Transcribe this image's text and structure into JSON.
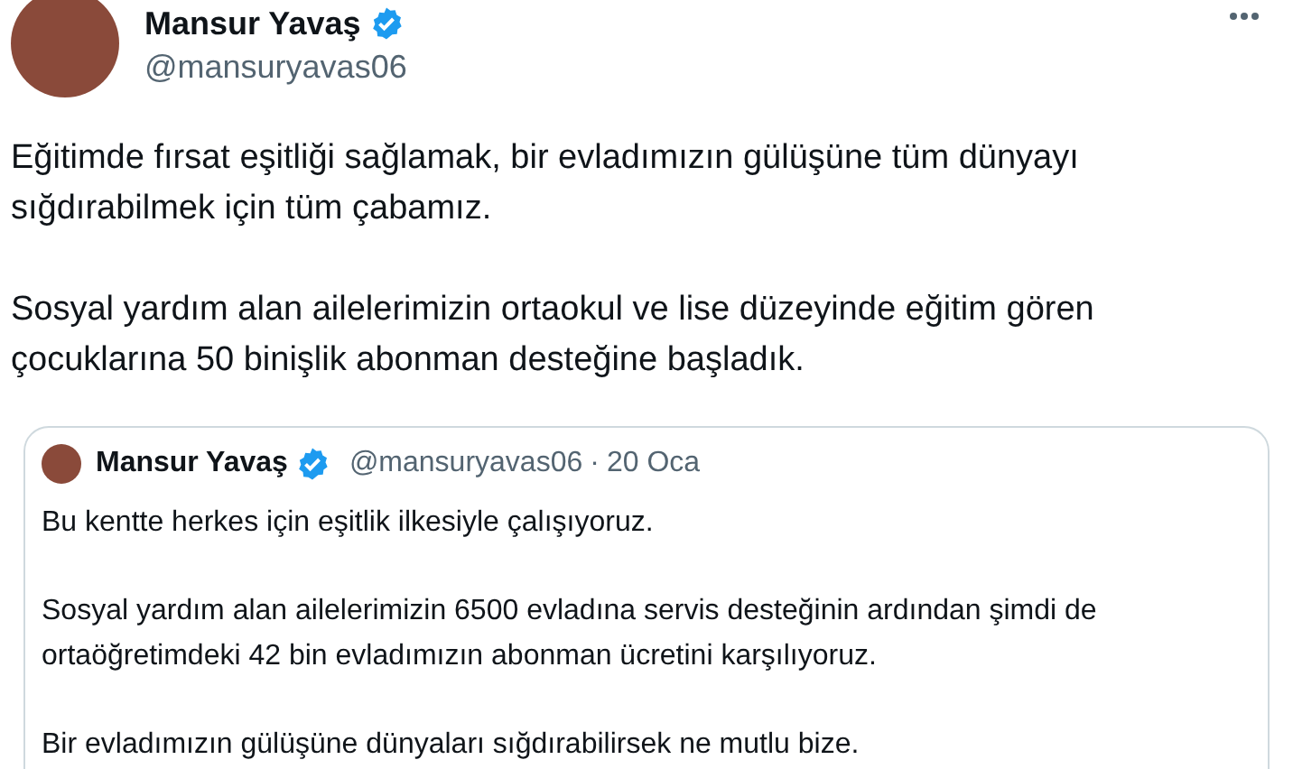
{
  "author": {
    "name": "Mansur Yavaş",
    "verified": true,
    "handle": "@mansuryavas06"
  },
  "text": [
    "Eğitimde fırsat eşitliği sağlamak, bir evladımızın gülüşüne tüm dünyayı sığdırabilmek için tüm çabamız.",
    "Sosyal yardım alan ailelerimizin ortaokul ve lise düzeyinde eğitim gören çocuklarına 50 binişlik abonman desteğine başladık."
  ],
  "quoted_tweet": {
    "author": {
      "name": "Mansur Yavaş",
      "verified": true,
      "handle": "@mansuryavas06",
      "separator": "·",
      "date": "20 Oca"
    },
    "text": [
      "Bu kentte herkes için eşitlik ilkesiyle çalışıyoruz.",
      "Sosyal yardım alan ailelerimizin 6500 evladına servis desteğinin ardından şimdi de ortaöğretimdeki 42 bin evladımızın abonman ücretini karşılıyoruz.",
      "Bir evladımızın gülüşüne dünyaları sığdırabilirsek ne mutlu bize."
    ]
  }
}
